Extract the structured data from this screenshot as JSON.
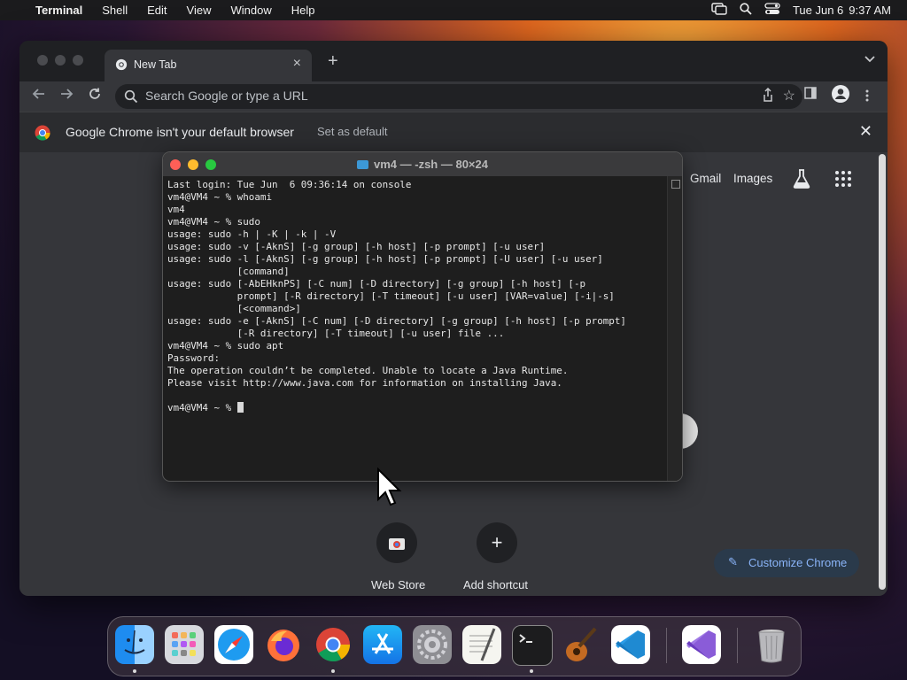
{
  "menubar": {
    "app": "Terminal",
    "items": [
      "Shell",
      "Edit",
      "View",
      "Window",
      "Help"
    ],
    "date": "Tue Jun 6",
    "time": "9:37 AM"
  },
  "chrome": {
    "tab_title": "New Tab",
    "omnibox_placeholder": "Search Google or type a URL",
    "infobar_message": "Google Chrome isn't your default browser",
    "infobar_action": "Set as default",
    "links": {
      "gmail": "Gmail",
      "images": "Images"
    },
    "shortcuts": [
      {
        "label": "Web Store",
        "icon": "web-store-icon"
      },
      {
        "label": "Add shortcut",
        "icon": "plus-icon"
      }
    ],
    "customize_label": "Customize Chrome"
  },
  "terminal": {
    "title": "vm4 — -zsh — 80×24",
    "lines": [
      "Last login: Tue Jun  6 09:36:14 on console",
      "vm4@VM4 ~ % whoami",
      "vm4",
      "vm4@VM4 ~ % sudo",
      "usage: sudo -h | -K | -k | -V",
      "usage: sudo -v [-AknS] [-g group] [-h host] [-p prompt] [-u user]",
      "usage: sudo -l [-AknS] [-g group] [-h host] [-p prompt] [-U user] [-u user]",
      "            [command]",
      "usage: sudo [-AbEHknPS] [-C num] [-D directory] [-g group] [-h host] [-p",
      "            prompt] [-R directory] [-T timeout] [-u user] [VAR=value] [-i|-s]",
      "            [<command>]",
      "usage: sudo -e [-AknS] [-C num] [-D directory] [-g group] [-h host] [-p prompt]",
      "            [-R directory] [-T timeout] [-u user] file ...",
      "vm4@VM4 ~ % sudo apt",
      "Password:",
      "The operation couldn’t be completed. Unable to locate a Java Runtime.",
      "Please visit http://www.java.com for information on installing Java.",
      "",
      "vm4@VM4 ~ % "
    ]
  },
  "dock": {
    "apps": [
      "Finder",
      "Launchpad",
      "Safari",
      "Firefox",
      "Google Chrome",
      "App Store",
      "System Settings",
      "TextEdit",
      "Terminal",
      "GarageBand",
      "Visual Studio Code",
      "Visual Studio",
      "Trash"
    ]
  },
  "colors": {
    "terminal_bg": "#1e1e1e",
    "chrome_bg": "#35363a",
    "accent_blue": "#8ab4f8"
  }
}
